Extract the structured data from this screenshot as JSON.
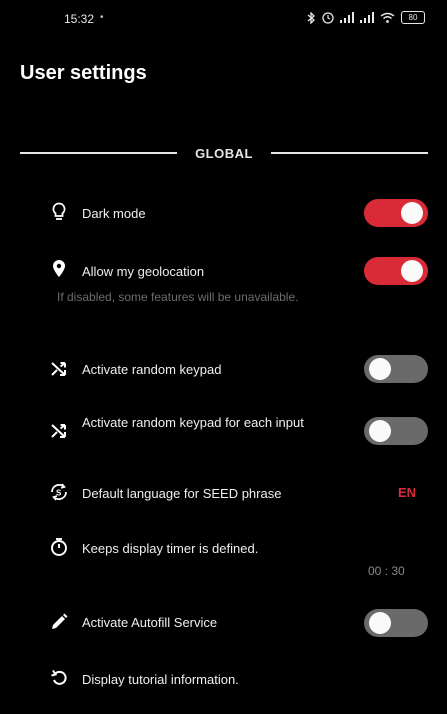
{
  "status_bar": {
    "time": "15:32",
    "indicator": "•",
    "icons": [
      "bluetooth-icon",
      "alarm-icon",
      "signal-icon",
      "signal-icon",
      "wifi-icon"
    ],
    "battery": "80"
  },
  "page": {
    "title": "User settings"
  },
  "section": {
    "title": "GLOBAL"
  },
  "settings": {
    "dark_mode": {
      "label": "Dark mode",
      "icon": "lightbulb-icon",
      "enabled": true
    },
    "geolocation": {
      "label": "Allow my geolocation",
      "icon": "location-pin-icon",
      "enabled": true,
      "subtitle": "If disabled, some features will be unavailable."
    },
    "random_keypad": {
      "label": "Activate random keypad",
      "icon": "shuffle-icon",
      "enabled": false
    },
    "random_keypad_each": {
      "label": "Activate random keypad for each input",
      "icon": "shuffle-icon",
      "enabled": false
    },
    "seed_language": {
      "label": "Default language for SEED phrase",
      "icon": "translate-icon",
      "value": "EN"
    },
    "display_timer": {
      "label": "Keeps display timer is defined.",
      "icon": "timer-icon",
      "value": "00 : 30"
    },
    "autofill": {
      "label": "Activate Autofill Service",
      "icon": "pencil-icon",
      "enabled": false
    },
    "tutorial": {
      "label": "Display tutorial information.",
      "icon": "replay-icon"
    }
  },
  "colors": {
    "accent": "#d92a37",
    "toggle_off": "#6a6a6a",
    "background": "#000000"
  }
}
